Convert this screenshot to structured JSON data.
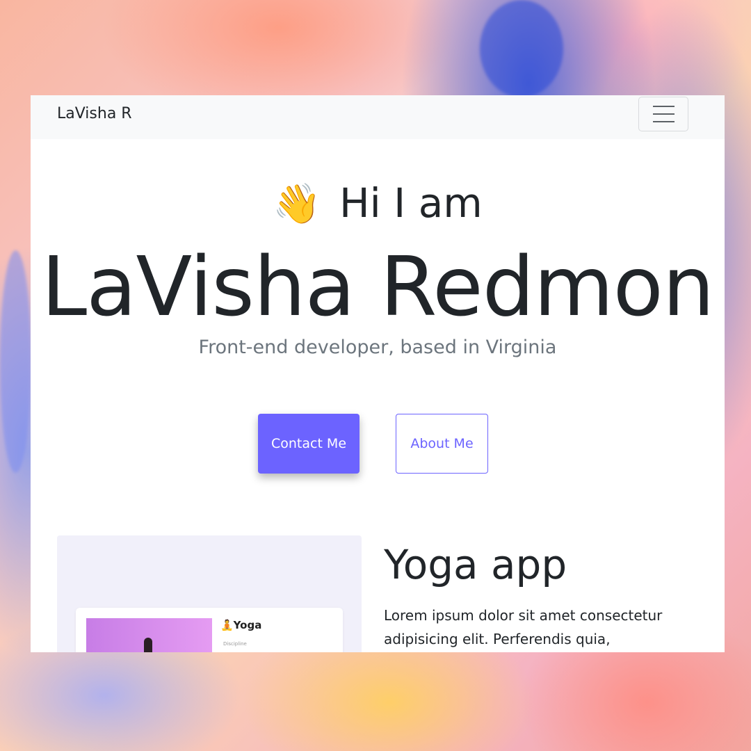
{
  "navbar": {
    "brand": "LaVisha R",
    "menu_icon": "hamburger-menu-icon"
  },
  "hero": {
    "wave_emoji": "👋",
    "greeting": "Hi I am",
    "name": "LaVisha Redmon",
    "subtitle": "Front-end developer, based in Virginia"
  },
  "buttons": {
    "contact": "Contact Me",
    "about": "About Me"
  },
  "project": {
    "title": "Yoga app",
    "description": "Lorem ipsum dolor sit amet consectetur adipisicing elit. Perferendis quia,",
    "preview": {
      "title": "🧘Yoga",
      "small_text": "Discipline"
    }
  },
  "colors": {
    "accent": "#6c63ff",
    "text": "#212529",
    "muted": "#6c757d",
    "navbar_bg": "#f8f9fa"
  }
}
